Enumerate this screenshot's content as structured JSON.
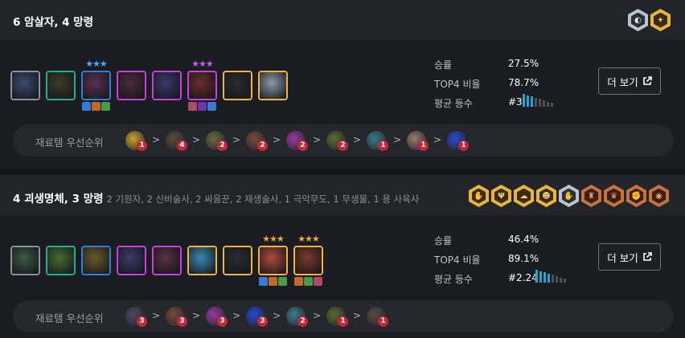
{
  "comps": [
    {
      "title": "6 암살자, 4 망령",
      "subtitle": "",
      "traits": [
        {
          "icon": "assassin-icon",
          "tier": "silver",
          "glyph": "◐"
        },
        {
          "icon": "wraith-icon",
          "tier": "gold",
          "glyph": "✦"
        }
      ],
      "champions": [
        {
          "name": "champion-1",
          "cost": 1,
          "color": "#3b4a6e",
          "stars": ""
        },
        {
          "name": "champion-2",
          "cost": 2,
          "color": "#3d3a2a",
          "stars": ""
        },
        {
          "name": "champion-3",
          "cost": 3,
          "color": "#5a3050",
          "stars": "★★★",
          "star_color": "#4aa7ff"
        },
        {
          "name": "champion-4",
          "cost": 4,
          "color": "#4a2a3a",
          "stars": ""
        },
        {
          "name": "champion-5",
          "cost": 4,
          "color": "#3a3a6a",
          "stars": ""
        },
        {
          "name": "champion-6",
          "cost": 4,
          "color": "#6a2e2a",
          "stars": "★★★",
          "star_color": "#c45cf0"
        },
        {
          "name": "champion-7",
          "cost": 5,
          "color": "#2a2a32",
          "stars": ""
        },
        {
          "name": "champion-8",
          "cost": 5,
          "color": "#8a9aaa",
          "stars": ""
        }
      ],
      "stats": {
        "winrate_label": "승률",
        "winrate": "27.5%",
        "top4_label": "TOP4 비율",
        "top4": "78.7%",
        "avg_label": "평균 등수",
        "avg": "#3",
        "placement_bars": [
          1,
          1,
          1,
          0,
          0,
          0,
          0,
          0
        ]
      },
      "more_label": "더 보기",
      "priority_label": "재료템 우선순위",
      "priority_items": [
        {
          "icon": "golden-spatula-icon",
          "count": "1",
          "color": "#c9a12a"
        },
        {
          "icon": "chain-vest-icon",
          "count": "4",
          "color": "#5a4a3a"
        },
        {
          "icon": "bf-sword-icon",
          "count": "2",
          "color": "#6a6a40"
        },
        {
          "icon": "giants-belt-icon",
          "count": "2",
          "color": "#7a4a3a"
        },
        {
          "icon": "tear-icon",
          "count": "2",
          "color": "#9a3aa0"
        },
        {
          "icon": "recurve-bow-icon",
          "count": "2",
          "color": "#5a6a30"
        },
        {
          "icon": "negatron-cloak-icon",
          "count": "1",
          "color": "#3a7a8a"
        },
        {
          "icon": "sparring-gloves-icon",
          "count": "1",
          "color": "#9a7a6a"
        },
        {
          "icon": "needlessly-large-rod-icon",
          "count": "1",
          "color": "#2a4ad0"
        }
      ]
    },
    {
      "title": "4 괴생명체, 3 망령",
      "subtitle": "2 기원자, 2 신비술사, 2 싸움꾼, 2 재생술사, 1 극악무도, 1 무생물, 1 용 사육사",
      "traits": [
        {
          "icon": "abomination-icon",
          "tier": "gold",
          "glyph": "✋"
        },
        {
          "icon": "wraith-icon",
          "tier": "gold",
          "glyph": "Ψ"
        },
        {
          "icon": "invoker-icon",
          "tier": "gold",
          "glyph": "☁"
        },
        {
          "icon": "mystic-icon",
          "tier": "gold",
          "glyph": "☻"
        },
        {
          "icon": "brawler-icon",
          "tier": "silver",
          "glyph": "✋"
        },
        {
          "icon": "renewer-icon",
          "tier": "bronze",
          "glyph": "♜"
        },
        {
          "icon": "hellion-icon",
          "tier": "bronze",
          "glyph": "♛"
        },
        {
          "icon": "inanimate-icon",
          "tier": "bronze",
          "glyph": "✊"
        },
        {
          "icon": "dragonmancer-icon",
          "tier": "bronze",
          "glyph": "◉"
        }
      ],
      "champions": [
        {
          "name": "champion-1",
          "cost": 1,
          "color": "#3a5a40",
          "stars": ""
        },
        {
          "name": "champion-2",
          "cost": 2,
          "color": "#4a6a30",
          "stars": ""
        },
        {
          "name": "champion-3",
          "cost": 3,
          "color": "#6a5a2a",
          "stars": ""
        },
        {
          "name": "champion-4",
          "cost": 4,
          "color": "#3a3a6a",
          "stars": ""
        },
        {
          "name": "champion-5",
          "cost": 4,
          "color": "#5a3040",
          "stars": ""
        },
        {
          "name": "champion-6",
          "cost": 5,
          "color": "#3a8ab0",
          "stars": ""
        },
        {
          "name": "champion-7",
          "cost": 5,
          "color": "#2a2a32",
          "stars": ""
        },
        {
          "name": "champion-8",
          "cost": 5,
          "color": "#b04a3a",
          "stars": "★★★",
          "star_color": "#f0a830"
        },
        {
          "name": "champion-9",
          "cost": 5,
          "color": "#7a3a2a",
          "stars": "★★★",
          "star_color": "#f0a830"
        }
      ],
      "stats": {
        "winrate_label": "승률",
        "winrate": "46.4%",
        "top4_label": "TOP4 비율",
        "top4": "89.1%",
        "avg_label": "평균 등수",
        "avg": "#2.24",
        "placement_bars": [
          1,
          1,
          1,
          1,
          0,
          0,
          0,
          0
        ]
      },
      "more_label": "더 보기",
      "priority_label": "재료템 우선순위",
      "priority_items": [
        {
          "icon": "bf-sword-icon",
          "count": "3",
          "color": "#4a4a60"
        },
        {
          "icon": "giants-belt-icon",
          "count": "3",
          "color": "#7a4a3a"
        },
        {
          "icon": "tear-icon",
          "count": "3",
          "color": "#9a3aa0"
        },
        {
          "icon": "needlessly-large-rod-icon",
          "count": "3",
          "color": "#2a4ad0"
        },
        {
          "icon": "negatron-cloak-icon",
          "count": "2",
          "color": "#3a7a8a"
        },
        {
          "icon": "recurve-bow-icon",
          "count": "1",
          "color": "#5a6a30"
        },
        {
          "icon": "chain-vest-icon",
          "count": "1",
          "color": "#5a4a3a"
        }
      ]
    }
  ]
}
